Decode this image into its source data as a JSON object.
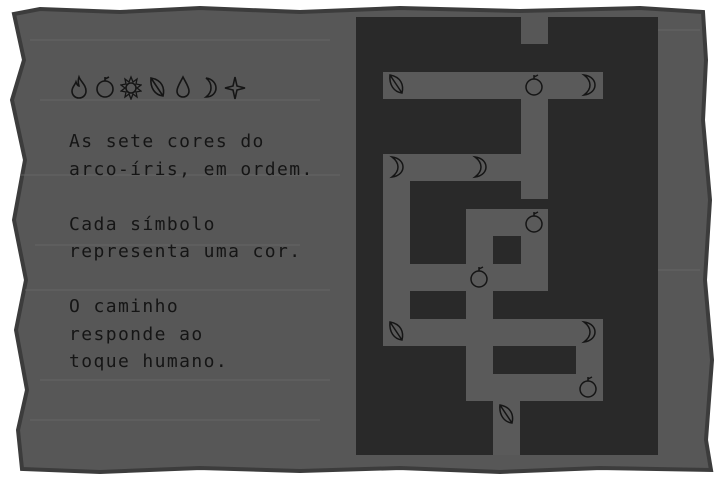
{
  "note": {
    "symbols": [
      "flame-icon",
      "orange-icon",
      "sun-icon",
      "leaf-icon",
      "drop-icon",
      "moon-icon",
      "star-icon"
    ],
    "paragraphs": [
      "As sete cores do\narco-íris, em ordem.",
      "Cada símbolo\nrepresenta uma cor.",
      "O caminho\nresponde ao\ntoque humano."
    ]
  },
  "maze": {
    "tiles": [
      {
        "icon": "leaf-icon"
      },
      {
        "icon": "orange-icon"
      },
      {
        "icon": "moon-icon"
      },
      {
        "icon": "moon-icon"
      },
      {
        "icon": "moon-icon"
      },
      {
        "icon": "orange-icon"
      },
      {
        "icon": "orange-icon"
      },
      {
        "icon": "leaf-icon"
      },
      {
        "icon": "moon-icon"
      },
      {
        "icon": "orange-icon"
      },
      {
        "icon": "leaf-icon"
      }
    ]
  },
  "colors": {
    "paper": "#575757",
    "paper_edge": "#3c3c3c",
    "maze_wall": "#292929",
    "path": "#5a5a5a",
    "ink": "#151515"
  }
}
